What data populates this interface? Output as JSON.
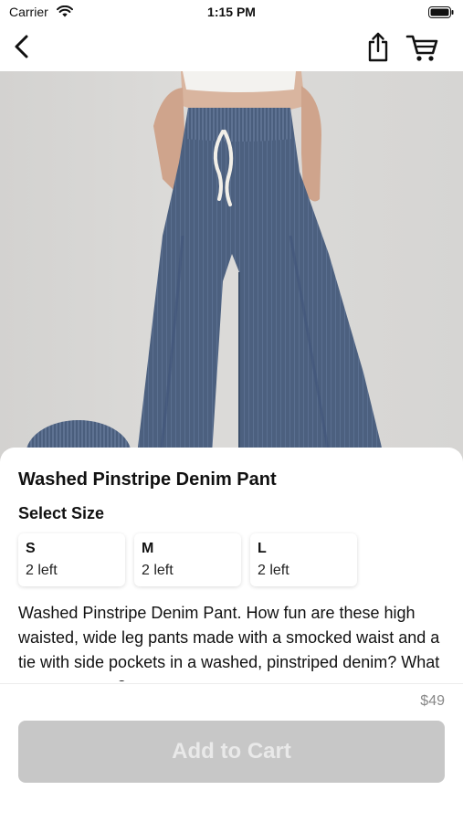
{
  "status_bar": {
    "carrier": "Carrier",
    "time": "1:15 PM"
  },
  "nav": {
    "icons": [
      "back-icon",
      "share-icon",
      "cart-icon"
    ]
  },
  "product": {
    "title": "Washed Pinstripe Denim Pant",
    "select_size_label": "Select Size",
    "sizes": [
      {
        "name": "S",
        "stock": "2 left"
      },
      {
        "name": "M",
        "stock": "2 left"
      },
      {
        "name": "L",
        "stock": "2 left"
      }
    ],
    "description": "Washed Pinstripe Denim Pant. How fun are these high waisted, wide leg pants made with a smocked waist and a tie with side pockets in a washed, pinstriped denim? What can go wrong?",
    "price": "$49"
  },
  "actions": {
    "add_to_cart_label": "Add to Cart"
  },
  "colors": {
    "button_disabled": "#c7c7c7",
    "denim": "#4b5f7e",
    "background": "#ffffff"
  }
}
